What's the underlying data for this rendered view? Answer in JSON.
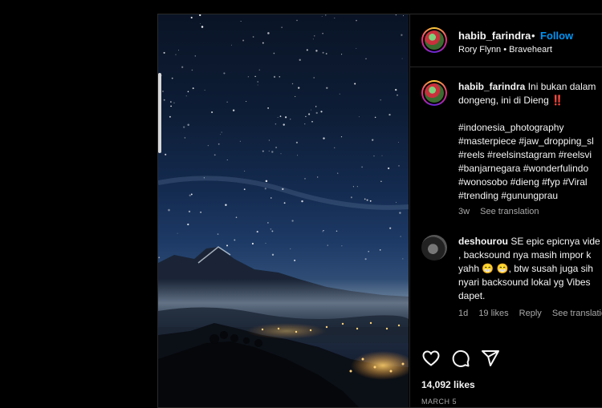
{
  "post": {
    "author": {
      "username": "habib_farindra",
      "separator": "•",
      "follow_label": "Follow",
      "audio": "Rory Flynn • Braveheart"
    },
    "caption": {
      "username": "habib_farindra",
      "lines": [
        " Ini bukan dalam",
        "dongeng, ini di Dieng ‼️",
        "",
        "#indonesia_photography",
        "#masterpiece #jaw_dropping_sl",
        "#reels #reelsinstagram #reelsvi",
        "#banjarnegara #wonderfulindo",
        "#wonosobo #dieng #fyp #Viral",
        "#trending #gunungprau"
      ],
      "time": "3w",
      "see_translation": "See translation"
    },
    "comment": {
      "username": "deshourou",
      "lines": [
        " SE epic epicnya vide",
        ", backsound nya masih impor k",
        "yahh 😁 😁, btw susah juga sih",
        "nyari backsound lokal yg Vibes",
        "dapet."
      ],
      "time": "1d",
      "likes": "19 likes",
      "reply": "Reply",
      "see_translation": "See translatio"
    },
    "likes": "14,092 likes",
    "date": "MARCH 5"
  },
  "colors": {
    "background": "#000000",
    "link_blue": "#0095f6",
    "muted": "#a8a8a8"
  },
  "icons": [
    "heart-icon",
    "comment-icon",
    "share-icon"
  ]
}
